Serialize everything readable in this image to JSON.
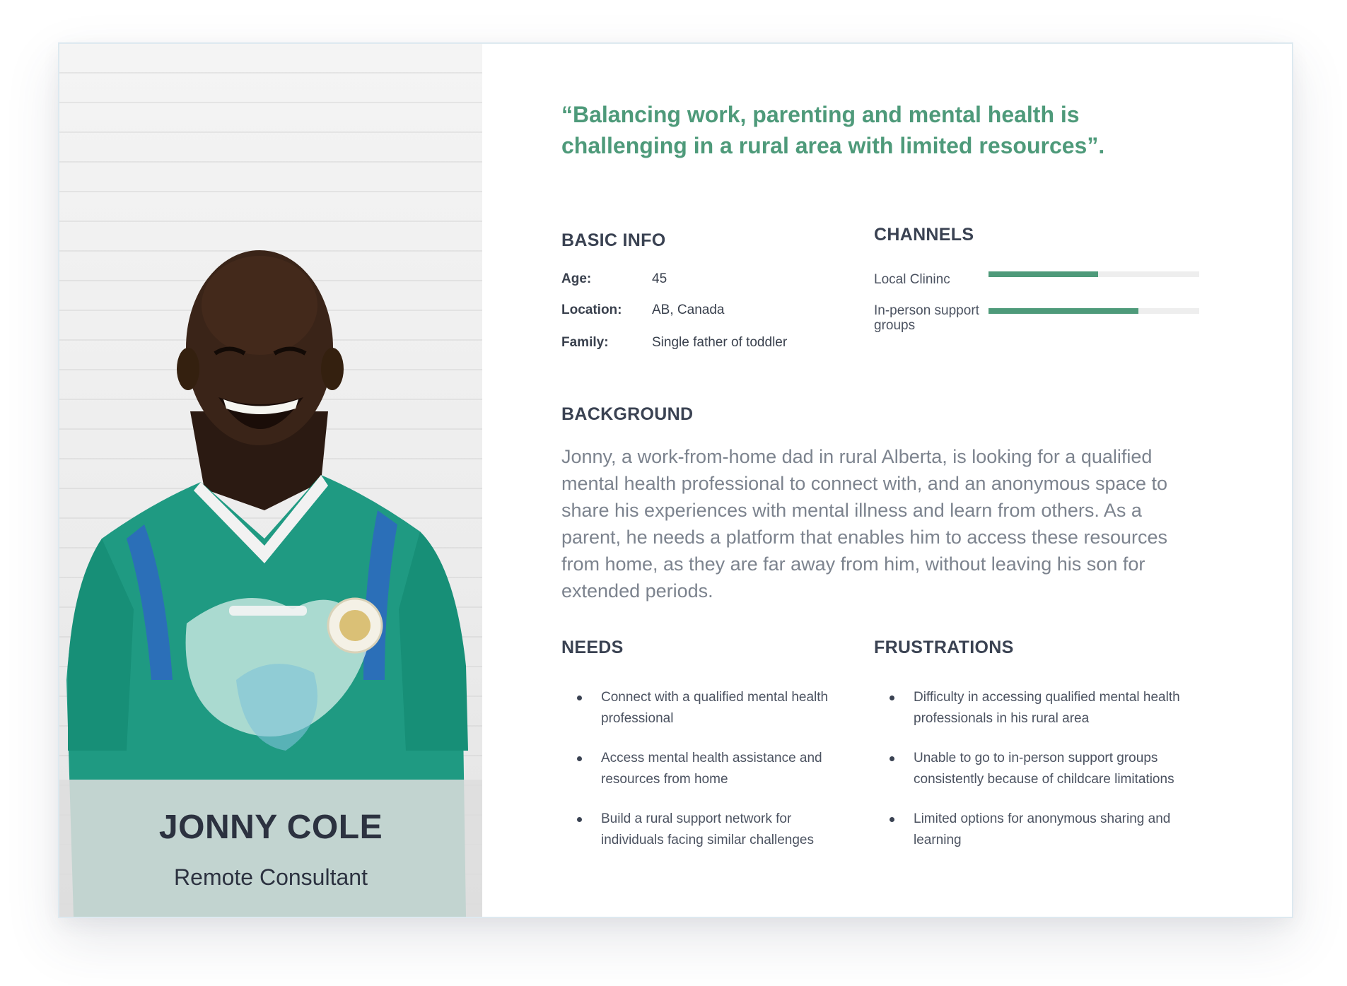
{
  "persona": {
    "name": "JONNY COLE",
    "role": "Remote Consultant",
    "photo_description_icon": "portrait-photo"
  },
  "quote": "“Balancing work, parenting and mental health is challenging in a rural area with limited resources”.",
  "basic_info": {
    "title": "BASIC INFO",
    "rows": [
      {
        "label": "Age:",
        "value": "45"
      },
      {
        "label": "Location:",
        "value": "AB, Canada"
      },
      {
        "label": "Family:",
        "value": "Single father of toddler"
      }
    ]
  },
  "channels": {
    "title": "CHANNELS",
    "items": [
      {
        "label": "Local Clininc",
        "level": 0.52
      },
      {
        "label": "In-person support groups",
        "level": 0.71
      }
    ]
  },
  "background": {
    "title": "BACKGROUND",
    "text": "Jonny, a work-from-home dad in rural Alberta, is looking for a qualified mental health professional to connect with, and an anonymous space to share his experiences with mental illness and learn from others. As a parent, he needs a platform that enables him to access these resources from home, as they are far away from him, without leaving his son for extended periods."
  },
  "needs": {
    "title": "NEEDS",
    "items": [
      "Connect with a qualified mental health professional",
      "Access mental health assistance and resources from home",
      "Build a rural support network for individuals facing similar challenges"
    ]
  },
  "frustrations": {
    "title": "FRUSTRATIONS",
    "items": [
      "Difficulty in accessing qualified mental health professionals in his rural area",
      "Unable to go to in-person support groups consistently because of childcare limitations",
      "Limited options for anonymous sharing and learning"
    ]
  },
  "colors": {
    "accent": "#4e9a7a",
    "heading": "#3a4252",
    "body": "#7c838e",
    "bar_track": "#eeeeee"
  }
}
